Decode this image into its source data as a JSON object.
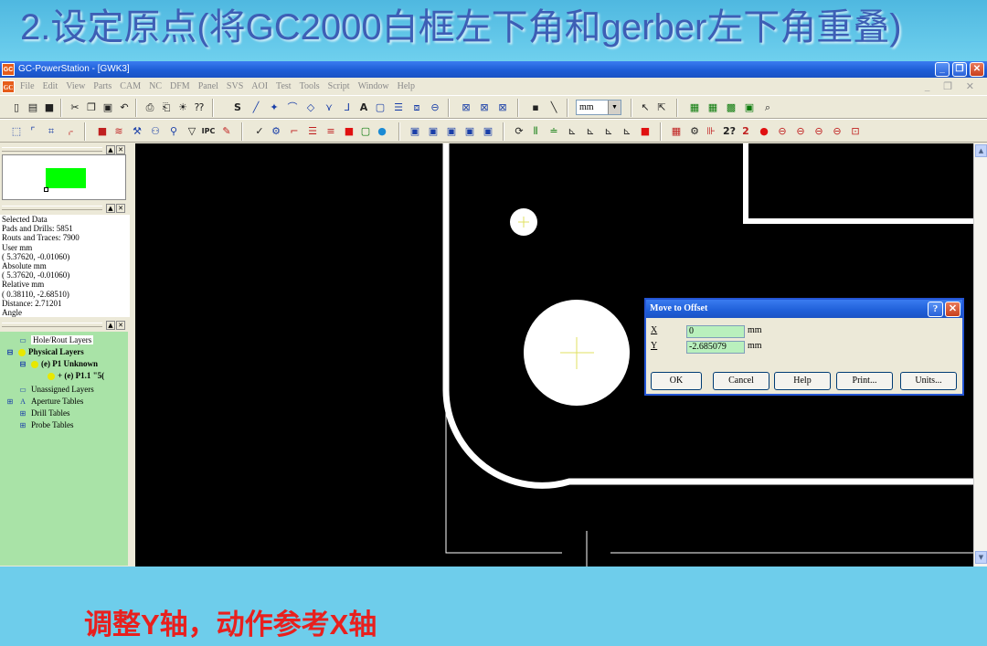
{
  "slide": {
    "title": "2.设定原点(将GC2000白框左下角和gerber左下角重叠)",
    "caption": "调整Y轴，动作参考X轴"
  },
  "window": {
    "app_icon": "GC",
    "title": "GC-PowerStation - [GWK3]",
    "min_symbol": "_",
    "max_symbol": "❐",
    "close_symbol": "✕"
  },
  "menu": {
    "items": [
      "File",
      "Edit",
      "View",
      "Parts",
      "CAM",
      "NC",
      "DFM",
      "Panel",
      "SVS",
      "AOI",
      "Test",
      "Tools",
      "Script",
      "Window",
      "Help"
    ],
    "mdi_controls": "_ ❐ ✕"
  },
  "toolbar": {
    "unit_value": "mm",
    "unit_arrow": "▼"
  },
  "panels": {
    "pin": "▲",
    "close": "✕"
  },
  "info": {
    "lines": [
      "Selected Data",
      "Pads and Drills: 5851",
      "Routs and Traces: 7900",
      "User mm",
      "( 5.37620, -0.01060)",
      "Absolute mm",
      "( 5.37620, -0.01060)",
      "Relative mm",
      "( 0.38110, -2.68510)",
      "Distance: 2.71201",
      "Angle"
    ]
  },
  "tree": {
    "hole_rout": "Hole/Rout Layers",
    "physical": "Physical Layers",
    "unknown": "(e) P1 Unknown",
    "layer": "+ (e) P1.1 \"5(",
    "unassigned": "Unassigned Layers",
    "aperture": "Aperture Tables",
    "drill": "Drill Tables",
    "probe": "Probe Tables",
    "expand_minus": "⊟",
    "expand_plus": "⊞"
  },
  "scroll": {
    "up": "▲",
    "down": "▼"
  },
  "dialog": {
    "title": "Move to Offset",
    "help_symbol": "?",
    "close_symbol": "✕",
    "x_label": "X",
    "x_value": "0",
    "y_label": "Y",
    "y_value": "-2.685079",
    "unit": "mm",
    "buttons": {
      "ok": "OK",
      "cancel": "Cancel",
      "help": "Help",
      "print": "Print...",
      "units": "Units..."
    }
  }
}
